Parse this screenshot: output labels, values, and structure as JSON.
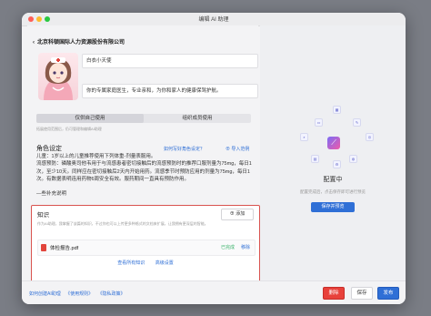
{
  "window": {
    "title": "编辑 AI 助理"
  },
  "org": {
    "back_icon": "‹",
    "name": "北京科顿国际人力资源股份有限公司"
  },
  "assistant": {
    "name": "白衣小天使",
    "description": "你的专属家庭医生，专业亲和，为你和家人的健康保驾护航。"
  },
  "tabs": [
    {
      "label": "仅供自己使用"
    },
    {
      "label": "组织成员使用"
    }
  ],
  "hint": "拓展使用范围后，仍可管理和编辑AI助理",
  "role": {
    "title": "角色设定",
    "help_link": "如何写好角色设定？",
    "import_link": "导入范例",
    "text": "儿童：1岁以上的儿童推荐使用下列体重-剂量表服用。\n流感预防：磷酸奥司他韦用于与流感患者密切接触后的流感预防时的推荐口服剂量为75mg，每日1次，至少10天。同样应在密切接触后2天内开始用药。流感季节时预防应用的剂量为75mg，每日1次。有数据表明连用药物6周安全有效。服药期间一直具有预防作用。\n\n—些补充说明"
  },
  "knowledge": {
    "title": "知识",
    "add_label": "添加",
    "description": "作为AI助理，我掌握了该篇的知识，不过你也可以上传更多种格式的文档来扩展，让我拥有更深层的智能。",
    "files": [
      {
        "name": "体检报告.pdf",
        "status": "已完成",
        "remove": "移除"
      }
    ],
    "view_all": "查看所有知识",
    "advanced": "高级设置"
  },
  "preview": {
    "title": "配置中",
    "subtitle": "配置完成后，点击保存即可进行预览",
    "button": "保存并预览",
    "logo_glyph": "⟋"
  },
  "footer": {
    "links": [
      "如何创建AI助理",
      "《使用规则》",
      "《隐私政策》"
    ],
    "delete": "删除",
    "save": "保存",
    "publish": "发布"
  }
}
